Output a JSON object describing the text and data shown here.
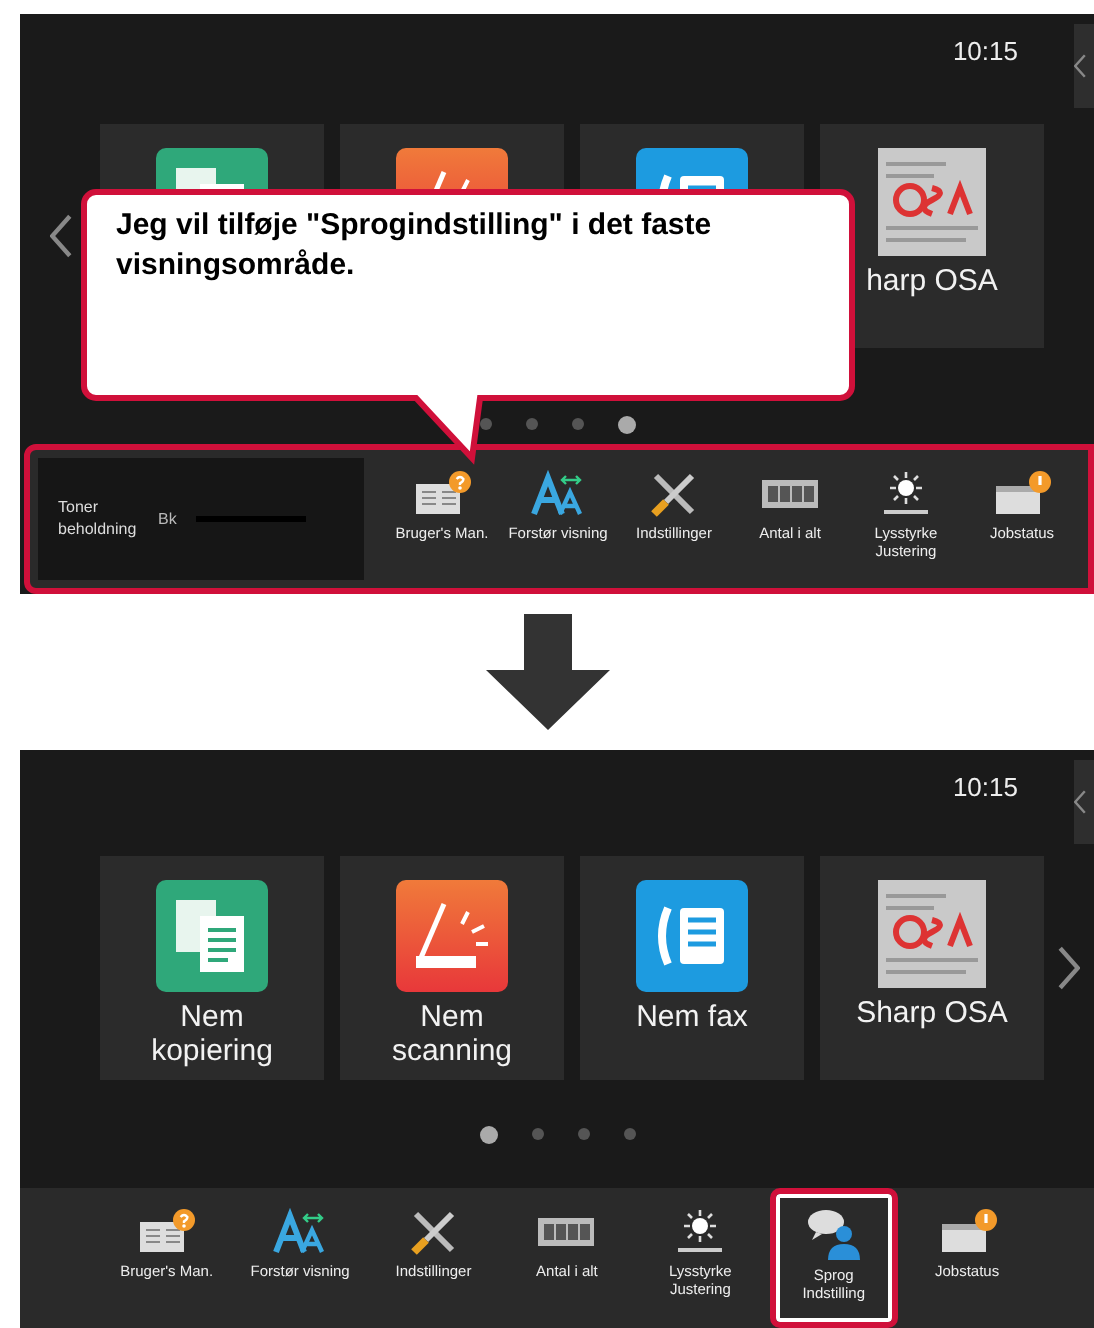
{
  "screens": [
    {
      "time": "10:15",
      "prev_arrow": true,
      "next_arrow": false,
      "tiles": [
        {
          "kind": "copy"
        },
        {
          "kind": "scan"
        },
        {
          "kind": "fax"
        },
        {
          "kind": "osa",
          "label": "harp OSA"
        }
      ],
      "page_dots": [
        {
          "selected": false
        },
        {
          "selected": false
        },
        {
          "selected": false
        },
        {
          "selected": true
        }
      ],
      "toner": {
        "label": "Toner beholdning",
        "color_label": "Bk"
      },
      "bar_highlighted": true,
      "shortcuts": [
        {
          "kind": "manual",
          "label": "Bruger's Man.",
          "highlighted": false
        },
        {
          "kind": "magnify",
          "label": "Forstør visning",
          "highlighted": false
        },
        {
          "kind": "tools",
          "label": "Indstillinger",
          "highlighted": false
        },
        {
          "kind": "counter",
          "label": "Antal i alt",
          "highlighted": false
        },
        {
          "kind": "brightness",
          "label": "Lysstyrke Justering",
          "highlighted": false
        },
        {
          "kind": "jobs",
          "label": "Jobstatus",
          "highlighted": false
        }
      ],
      "callout": {
        "text": "Jeg vil tilføje \"Sprogindstilling\" i det faste visningsområde."
      }
    },
    {
      "time": "10:15",
      "prev_arrow": false,
      "next_arrow": true,
      "tiles": [
        {
          "kind": "copy",
          "label": "Nem kopiering"
        },
        {
          "kind": "scan",
          "label": "Nem scanning"
        },
        {
          "kind": "fax",
          "label": "Nem fax"
        },
        {
          "kind": "osa",
          "label": "Sharp OSA"
        }
      ],
      "page_dots": [
        {
          "selected": true
        },
        {
          "selected": false
        },
        {
          "selected": false
        },
        {
          "selected": false
        }
      ],
      "bar_highlighted": false,
      "shortcuts": [
        {
          "kind": "manual",
          "label": "Bruger's Man.",
          "highlighted": false
        },
        {
          "kind": "magnify",
          "label": "Forstør visning",
          "highlighted": false
        },
        {
          "kind": "tools",
          "label": "Indstillinger",
          "highlighted": false
        },
        {
          "kind": "counter",
          "label": "Antal i alt",
          "highlighted": false
        },
        {
          "kind": "brightness",
          "label": "Lysstyrke Justering",
          "highlighted": false
        },
        {
          "kind": "language",
          "label": "Sprog Indstilling",
          "highlighted": true
        },
        {
          "kind": "jobs",
          "label": "Jobstatus",
          "highlighted": false
        }
      ]
    }
  ]
}
